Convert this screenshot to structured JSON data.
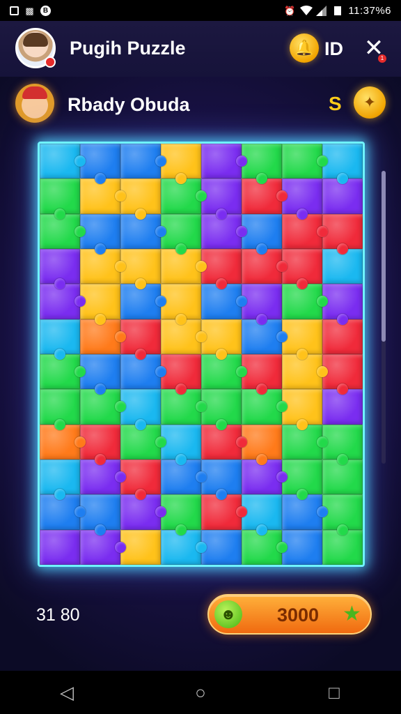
{
  "status_bar": {
    "time": "11:37%6",
    "icons_left": [
      "photo-icon",
      "lock-icon",
      "circle-b-icon"
    ],
    "icons_right": [
      "alarm-icon",
      "wifi-icon",
      "signal-icon",
      "battery-icon"
    ]
  },
  "header": {
    "app_title": "Pugih Puzzle",
    "id_label": "ID",
    "close_badge": "1"
  },
  "player": {
    "name": "Rbady Obuda",
    "currency_symbol": "S"
  },
  "board": {
    "columns": 8,
    "rows": 12,
    "palette": {
      "G": "#22d94a",
      "B": "#1e7ef0",
      "C": "#1ab8f0",
      "Y": "#ffc21a",
      "P": "#7a2df0",
      "R": "#f02a3a",
      "O": "#ff7a1a"
    },
    "pieces": [
      "CBBYPGGC",
      "GYYGPRPP",
      "GBBGPBRR",
      "PYYYRRRC",
      "PYBYBPGP",
      "CORYYBYR",
      "GBBRGRYR",
      "GGCGGGYP",
      "ORGCROGG",
      "CPRBBPGG",
      "BBPGRCBG",
      "PPYCBGBG"
    ]
  },
  "footer": {
    "score": "31 80",
    "buy_price": "3000"
  }
}
